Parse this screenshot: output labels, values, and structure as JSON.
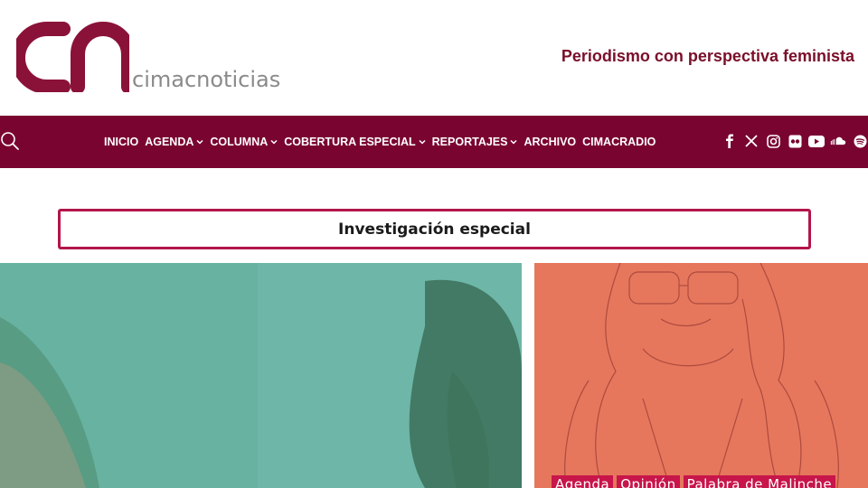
{
  "header": {
    "logo_mark": "cn",
    "logo_text": "cimacnoticias",
    "tagline": "Periodismo con perspectiva feminista"
  },
  "nav": {
    "items": [
      {
        "label": "INICIO",
        "dropdown": false
      },
      {
        "label": "AGENDA",
        "dropdown": true
      },
      {
        "label": "COLUMNA",
        "dropdown": true
      },
      {
        "label": "COBERTURA ESPECIAL",
        "dropdown": true
      },
      {
        "label": "REPORTAJES",
        "dropdown": true
      },
      {
        "label": "ARCHIVO",
        "dropdown": false
      },
      {
        "label": "CIMACRADIO",
        "dropdown": false
      }
    ],
    "socials": [
      "facebook-icon",
      "x-icon",
      "instagram-icon",
      "flickr-icon",
      "youtube-icon",
      "soundcloud-icon",
      "spotify-icon"
    ]
  },
  "section": {
    "title": "Investigación especial"
  },
  "side_article": {
    "tags": [
      "Agenda",
      "Opinión",
      "Palabra de Malinche"
    ]
  },
  "colors": {
    "brand": "#7a0430",
    "tagline": "#7a0f2a",
    "accent_border": "#b3154a",
    "tag_bg": "#c8154a"
  }
}
